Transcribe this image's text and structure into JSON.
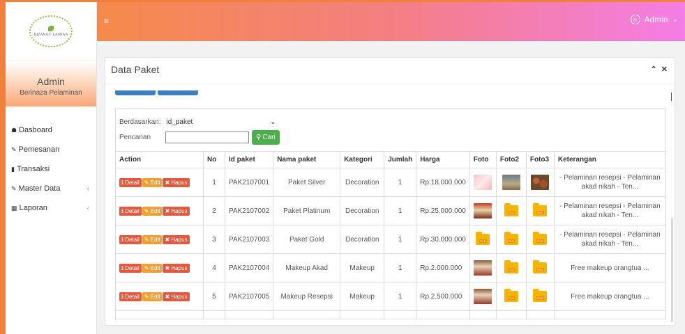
{
  "brand": {
    "logo_text": "RIZANGU LAMINA"
  },
  "sidebar": {
    "user_name": "Admin",
    "user_sub": "Berinaza Pelaminan",
    "items": [
      {
        "label": "Dasboard",
        "icon": "home-icon"
      },
      {
        "label": "Pemesanan",
        "icon": "pencil-icon"
      },
      {
        "label": "Transaksi",
        "icon": "book-icon"
      },
      {
        "label": "Master Data",
        "icon": "edit-icon"
      },
      {
        "label": "Laporan",
        "icon": "calendar-icon"
      }
    ]
  },
  "topbar": {
    "menu_icon": "hamburger-icon",
    "user_label": "Admin"
  },
  "panel": {
    "title": "Data Paket"
  },
  "filter": {
    "by_label": "Berdasarkan:",
    "by_value": "id_paket",
    "search_label": "Pencarian",
    "search_value": "",
    "search_button": "Cari"
  },
  "table": {
    "headers": [
      "Action",
      "No",
      "Id paket",
      "Nama paket",
      "Kategori",
      "Jumlah",
      "Harga",
      "Foto",
      "Foto2",
      "Foto3",
      "Keterangan"
    ],
    "action_labels": {
      "detail": "Detail",
      "edit": "Edit",
      "hapus": "Hapus"
    },
    "rows": [
      {
        "no": "1",
        "id": "PAK2107001",
        "nama": "Paket Silver",
        "kategori": "Decoration",
        "jumlah": "1",
        "harga": "Rp.18.000.000",
        "ket": "- Pelaminan resepsi - Pelaminan akad nikah - Ten..."
      },
      {
        "no": "2",
        "id": "PAK2107002",
        "nama": "Paket Platinum",
        "kategori": "Decoration",
        "jumlah": "1",
        "harga": "Rp.25.000.000",
        "ket": "- Pelaminan resepsi - Pelaminan akad nikah - Ten..."
      },
      {
        "no": "3",
        "id": "PAK2107003",
        "nama": "Paket Gold",
        "kategori": "Decoration",
        "jumlah": "1",
        "harga": "Rp.30.000.000",
        "ket": "- Pelaminan resepsi - Pelaminan akad nikah - Ten..."
      },
      {
        "no": "4",
        "id": "PAK2107004",
        "nama": "Makeup Akad",
        "kategori": "Makeup",
        "jumlah": "1",
        "harga": "Rp.2.000.000",
        "ket": "Free makeup orangtua ..."
      },
      {
        "no": "5",
        "id": "PAK2107005",
        "nama": "Makeup Resepsi",
        "kategori": "Makeup",
        "jumlah": "1",
        "harga": "Rp.2.500.000",
        "ket": "Free makeup orangtua ..."
      }
    ],
    "file_badge": "FILE"
  },
  "colors": {
    "accent": "#f0813a",
    "topbar_start": "#f58a4a",
    "topbar_end": "#f47de6",
    "btn_green": "#4cae4c",
    "btn_blue": "#3c7ebf"
  }
}
